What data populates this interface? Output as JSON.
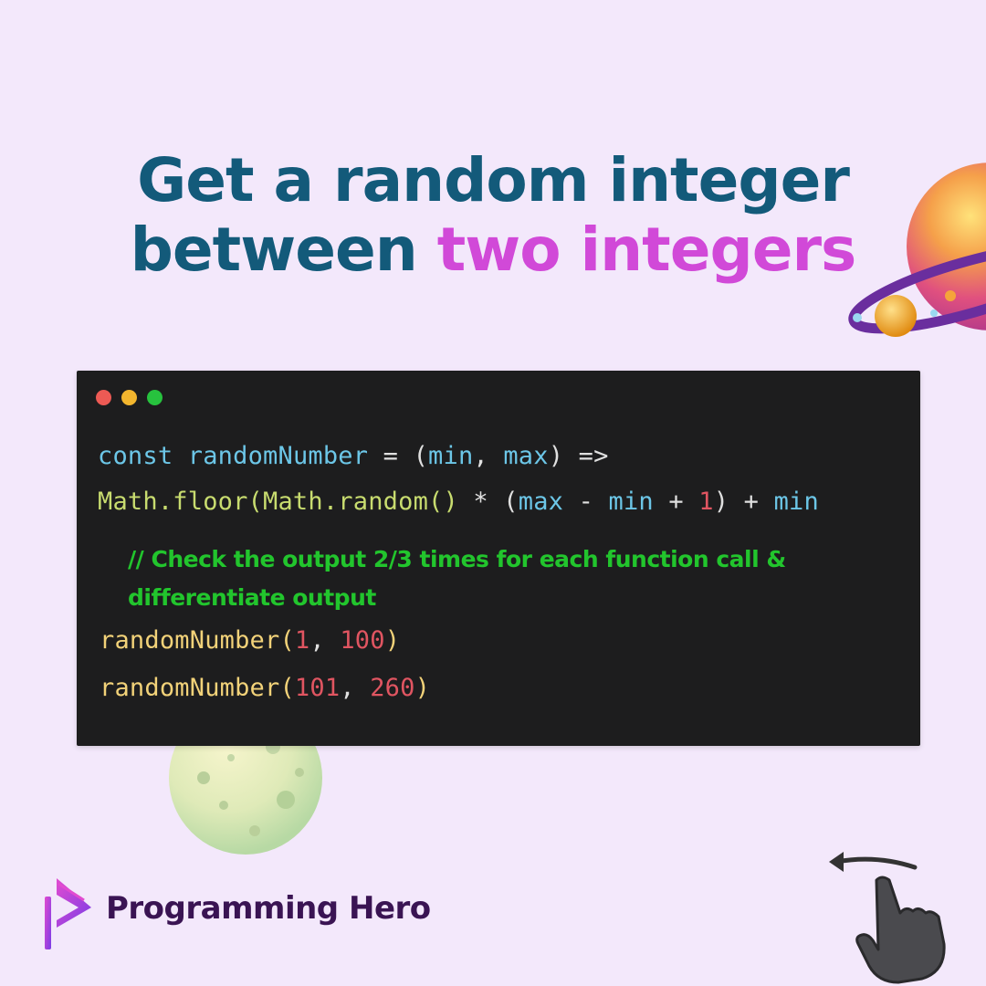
{
  "title": {
    "line1": "Get a random integer",
    "line2_start": "between ",
    "line2_highlight": "two integers"
  },
  "editor": {
    "window_buttons": [
      "close",
      "minimize",
      "maximize"
    ],
    "line1": [
      {
        "t": "const",
        "c": "kw"
      },
      {
        "t": " ",
        "c": "op"
      },
      {
        "t": "randomNumber",
        "c": "id"
      },
      {
        "t": " = (",
        "c": "op"
      },
      {
        "t": "min",
        "c": "id"
      },
      {
        "t": ", ",
        "c": "op"
      },
      {
        "t": "max",
        "c": "id"
      },
      {
        "t": ") =>",
        "c": "op"
      }
    ],
    "line2": [
      {
        "t": "Math.floor(Math.random()",
        "c": "fn"
      },
      {
        "t": " * (",
        "c": "op"
      },
      {
        "t": "max",
        "c": "id"
      },
      {
        "t": " - ",
        "c": "op"
      },
      {
        "t": "min",
        "c": "id"
      },
      {
        "t": " + ",
        "c": "op"
      },
      {
        "t": "1",
        "c": "num"
      },
      {
        "t": ") + ",
        "c": "op"
      },
      {
        "t": "min",
        "c": "id"
      }
    ],
    "comment": "// Check the output 2/3 times for each function call & differentiate output",
    "line3": [
      {
        "t": "randomNumber(",
        "c": "call"
      },
      {
        "t": "1",
        "c": "num"
      },
      {
        "t": ", ",
        "c": "op"
      },
      {
        "t": "100",
        "c": "num"
      },
      {
        "t": ")",
        "c": "call"
      }
    ],
    "line4": [
      {
        "t": "randomNumber(",
        "c": "call"
      },
      {
        "t": "101",
        "c": "num"
      },
      {
        "t": ", ",
        "c": "op"
      },
      {
        "t": "260",
        "c": "num"
      },
      {
        "t": ")",
        "c": "call"
      }
    ]
  },
  "brand": {
    "name": "Programming Hero"
  },
  "icons": [
    "planet-icon",
    "moon-icon",
    "logo-icon",
    "swipe-hand-icon"
  ],
  "colors": {
    "background": "#f3e8fb",
    "title": "#135a7a",
    "title_highlight": "#d149d8",
    "editor_bg": "#1d1d1e",
    "comment": "#22c52d",
    "dot_red": "#ed5a54",
    "dot_yellow": "#f3b62e",
    "dot_green": "#27c23e"
  }
}
